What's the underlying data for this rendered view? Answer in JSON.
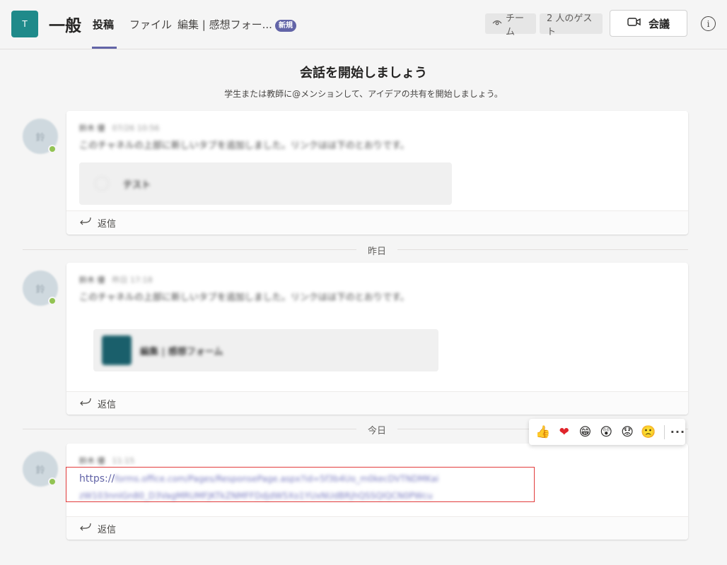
{
  "header": {
    "team_avatar": "T",
    "channel_name": "一般",
    "tabs": [
      {
        "label": "投稿"
      },
      {
        "label": "ファイル"
      },
      {
        "label": "編集 | 感想フォー..."
      }
    ],
    "new_badge": "新規",
    "team_pill": "チーム",
    "guests_pill": "2 人のゲスト",
    "meet_label": "会議",
    "info_label": "i"
  },
  "intro": {
    "title": "会話を開始しましょう",
    "subtitle": "学生または教師に@メンションして、アイデアの共有を開始しましょう。"
  },
  "posts": [
    {
      "avatar": "鈴",
      "author": "鈴木 優",
      "time": "07/26 10:56",
      "text": "このチャネルの上部に新しいタブを追加しました。リンクはは下のとおりです。",
      "attachment": "テスト",
      "reply_label": "返信"
    },
    {
      "avatar": "鈴",
      "author": "鈴木 優",
      "time": "昨日 17:18",
      "text": "このチャネルの上部に新しいタブを追加しました。リンクはは下のとおりです。",
      "attachment": "編集 | 感想フォーム",
      "reply_label": "返信"
    },
    {
      "avatar": "鈴",
      "author": "鈴木 優",
      "time": "11:15",
      "link_prefix": "https://",
      "link_rest1": "forms.office.com/Pages/ResponsePage.aspx?id=5f3b4Uo_m0kecDVTNDMKai",
      "link_rest2": "zW103nnIGn80_D3VagMRUMFJKTkZNMFFDdjdW5Xo1YUxNUdBRjhQSSQlQCN0PWcu",
      "reply_label": "返信"
    }
  ],
  "dividers": {
    "yesterday": "昨日",
    "today": "今日"
  },
  "reactions": {
    "like": "👍",
    "heart": "❤",
    "laugh": "😁",
    "surprised": "😲",
    "sad": "😟",
    "angry": "🙁",
    "more": "···"
  },
  "colors": {
    "accent": "#6264a7",
    "presence": "#92c353",
    "highlight": "#e23c3c"
  }
}
